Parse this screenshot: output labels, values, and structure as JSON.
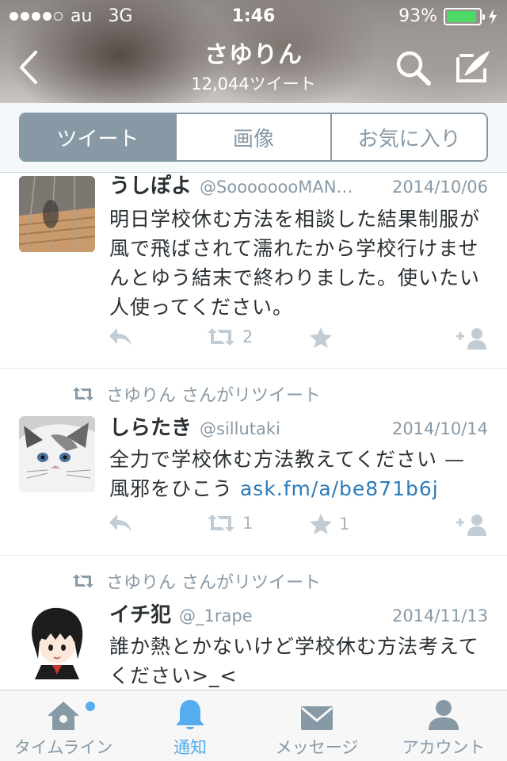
{
  "status_bar": {
    "carrier": "au",
    "network": "3G",
    "time": "1:46",
    "battery": "93%",
    "battery_level": 0.93,
    "battery_color": "#4cd964"
  },
  "header": {
    "title": "さゆりん",
    "subtitle": "12,044ツイート",
    "back_icon": "chevron-left-icon",
    "search_icon": "search-icon",
    "compose_icon": "compose-icon"
  },
  "segments": {
    "items": [
      "ツイート",
      "画像",
      "お気に入り"
    ],
    "selected": "ツイート"
  },
  "tweets": [
    {
      "name": "うしぽよ",
      "handle": "@SoooooooMAN…",
      "date": "2014/10/06",
      "text": "明日学校休む方法を相談した結果制服が風で飛ばされて濡れたから学校行けませんとゆう結末で終わりました。使いたい人使ってください。",
      "retweets": "2",
      "favorites": ""
    },
    {
      "retweeted_by": "さゆりん さんがリツイート",
      "name": "しらたき",
      "handle": "@sillutaki",
      "date": "2014/10/14",
      "text": "全力で学校休む方法教えてください — 風邪をひこう",
      "link": "ask.fm/a/be871b6j",
      "retweets": "1",
      "favorites": "1"
    },
    {
      "retweeted_by": "さゆりん さんがリツイート",
      "name": "イチ犯",
      "handle": "@_1rape",
      "date": "2014/11/13",
      "text": "誰か熱とかないけど学校休む方法考えてください>_<"
    }
  ],
  "tabbar": {
    "items": [
      {
        "label": "タイムライン",
        "icon": "home-icon"
      },
      {
        "label": "通知",
        "icon": "bell-icon"
      },
      {
        "label": "メッセージ",
        "icon": "envelope-icon"
      },
      {
        "label": "アカウント",
        "icon": "person-icon"
      }
    ],
    "active": "通知",
    "accent_color": "#55acee"
  }
}
